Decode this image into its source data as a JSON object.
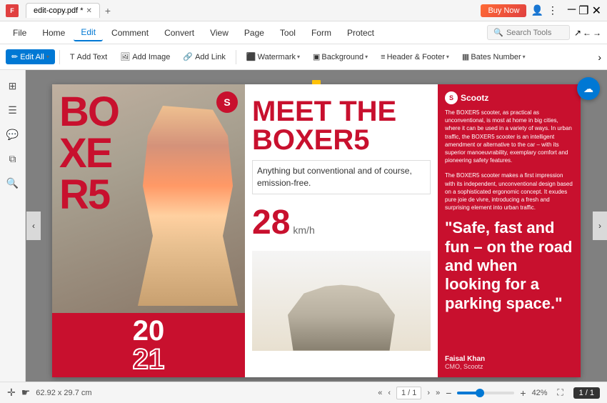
{
  "titleBar": {
    "fileName": "edit-copy.pdf *",
    "buyNow": "Buy Now",
    "newTab": "+"
  },
  "menuBar": {
    "items": [
      {
        "label": "File",
        "active": false
      },
      {
        "label": "Home",
        "active": false
      },
      {
        "label": "Edit",
        "active": true
      },
      {
        "label": "Comment",
        "active": false
      },
      {
        "label": "Convert",
        "active": false
      },
      {
        "label": "View",
        "active": false
      },
      {
        "label": "Page",
        "active": false
      },
      {
        "label": "Tool",
        "active": false
      },
      {
        "label": "Form",
        "active": false
      },
      {
        "label": "Protect",
        "active": false
      }
    ],
    "searchPlaceholder": "Search Tools"
  },
  "toolbar": {
    "editAll": "Edit All",
    "addText": "Add Text",
    "addImage": "Add Image",
    "addLink": "Add Link",
    "watermark": "Watermark",
    "background": "Background",
    "headerFooter": "Header & Footer",
    "batesNumber": "Bates Number"
  },
  "pdf": {
    "leftSection": {
      "title": "BOXER5",
      "titleLines": [
        "BO",
        "XE",
        "R5"
      ],
      "year": "20",
      "year2": "21",
      "logoSymbol": "S"
    },
    "middleSection": {
      "meetTitle": "MEET THE BOXER5",
      "subtitle": "Anything but conventional and of course, emission-free.",
      "speed": "28",
      "speedUnit": "km/h"
    },
    "rightSection": {
      "brandName": "Scootz",
      "description1": "The BOXER5 scooter, as practical as unconventional, is most at home in big cities, where it can be used in a variety of ways. In urban traffic, the BOXER5 scooter is an intelligent amendment or alternative to the car – with its superior manoeuvrability, exemplary comfort and pioneering safety features.",
      "description2": "The BOXER5 scooter makes a first impression with its independent, unconventional design based on a sophisticated ergonomic concept. It exudes pure joie de vivre, introducing a fresh and surprising element into urban traffic.",
      "quote": "\"Safe, fast and fun – on the road and when looking for a parking space.\"",
      "authorName": "Faisal Khan",
      "authorTitle": "CMO, Scootz"
    }
  },
  "statusBar": {
    "dimensions": "62.92 x 29.7 cm",
    "pageIndicator": "1 / 1",
    "pageInput": "1 / 1",
    "zoom": "42%"
  },
  "icons": {
    "thumbnail": "⊞",
    "bookmark": "🔖",
    "comment": "💬",
    "layers": "⧉",
    "search": "🔍",
    "navLeft": "‹",
    "navRight": "›",
    "navFirst": "«",
    "navLast": "»",
    "zoomOut": "−",
    "zoomIn": "+",
    "cursor": "⊕",
    "hand": "✋",
    "fullscreen": "⛶",
    "cloud": "☁",
    "edit": "✏",
    "editAll": "✏",
    "addText": "T",
    "addImage": "🖼",
    "addLink": "🔗",
    "watermark": "W",
    "background": "▣",
    "headerFooter": "≡",
    "bates": "B",
    "chevronDown": "▾"
  }
}
